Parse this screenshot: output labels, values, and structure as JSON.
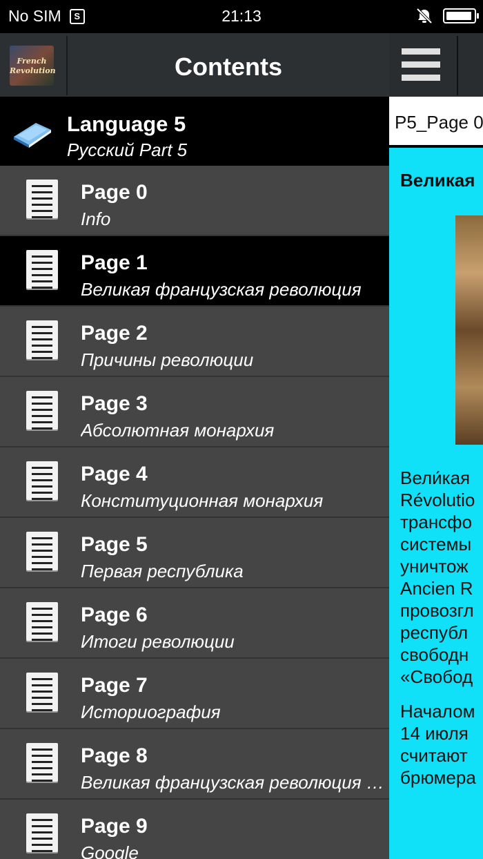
{
  "status_bar": {
    "carrier": "No SIM",
    "sim_glyph": "S",
    "time": "21:13",
    "battery_level": 0.95
  },
  "drawer": {
    "app_logo_text": "French Revolution",
    "title": "Contents",
    "section": {
      "title": "Language 5",
      "subtitle": "Русский Part 5"
    },
    "items": [
      {
        "title": "Page 0",
        "subtitle": "Info",
        "active": false
      },
      {
        "title": "Page 1",
        "subtitle": "Великая французская революция",
        "active": true
      },
      {
        "title": "Page 2",
        "subtitle": "Причины революции",
        "active": false
      },
      {
        "title": "Page 3",
        "subtitle": "Абсолютная монархия",
        "active": false
      },
      {
        "title": "Page 4",
        "subtitle": "Конституционная монархия",
        "active": false
      },
      {
        "title": "Page 5",
        "subtitle": "Первая республика",
        "active": false
      },
      {
        "title": "Page 6",
        "subtitle": "Итоги революции",
        "active": false
      },
      {
        "title": "Page 7",
        "subtitle": "Историография",
        "active": false
      },
      {
        "title": "Page 8",
        "subtitle": "Великая французская революция в кино",
        "active": false
      },
      {
        "title": "Page 9",
        "subtitle": "Google",
        "active": false
      }
    ]
  },
  "content": {
    "tab_label": "P5_Page 0",
    "heading": "Великая",
    "paragraph1": [
      "Вели́кая",
      "Révolutio",
      "трансфо",
      "системы",
      "уничтож",
      "Ancien R",
      "провозгл",
      "республ",
      "свободн",
      "«Свобод"
    ],
    "paragraph2": [
      "Началом",
      "14 июля",
      "считают",
      "брюмера"
    ]
  },
  "colors": {
    "drawer_bg": "#454545",
    "active_bg": "#000000",
    "header_bg": "#2d3033",
    "content_bg": "#11e1f8"
  }
}
